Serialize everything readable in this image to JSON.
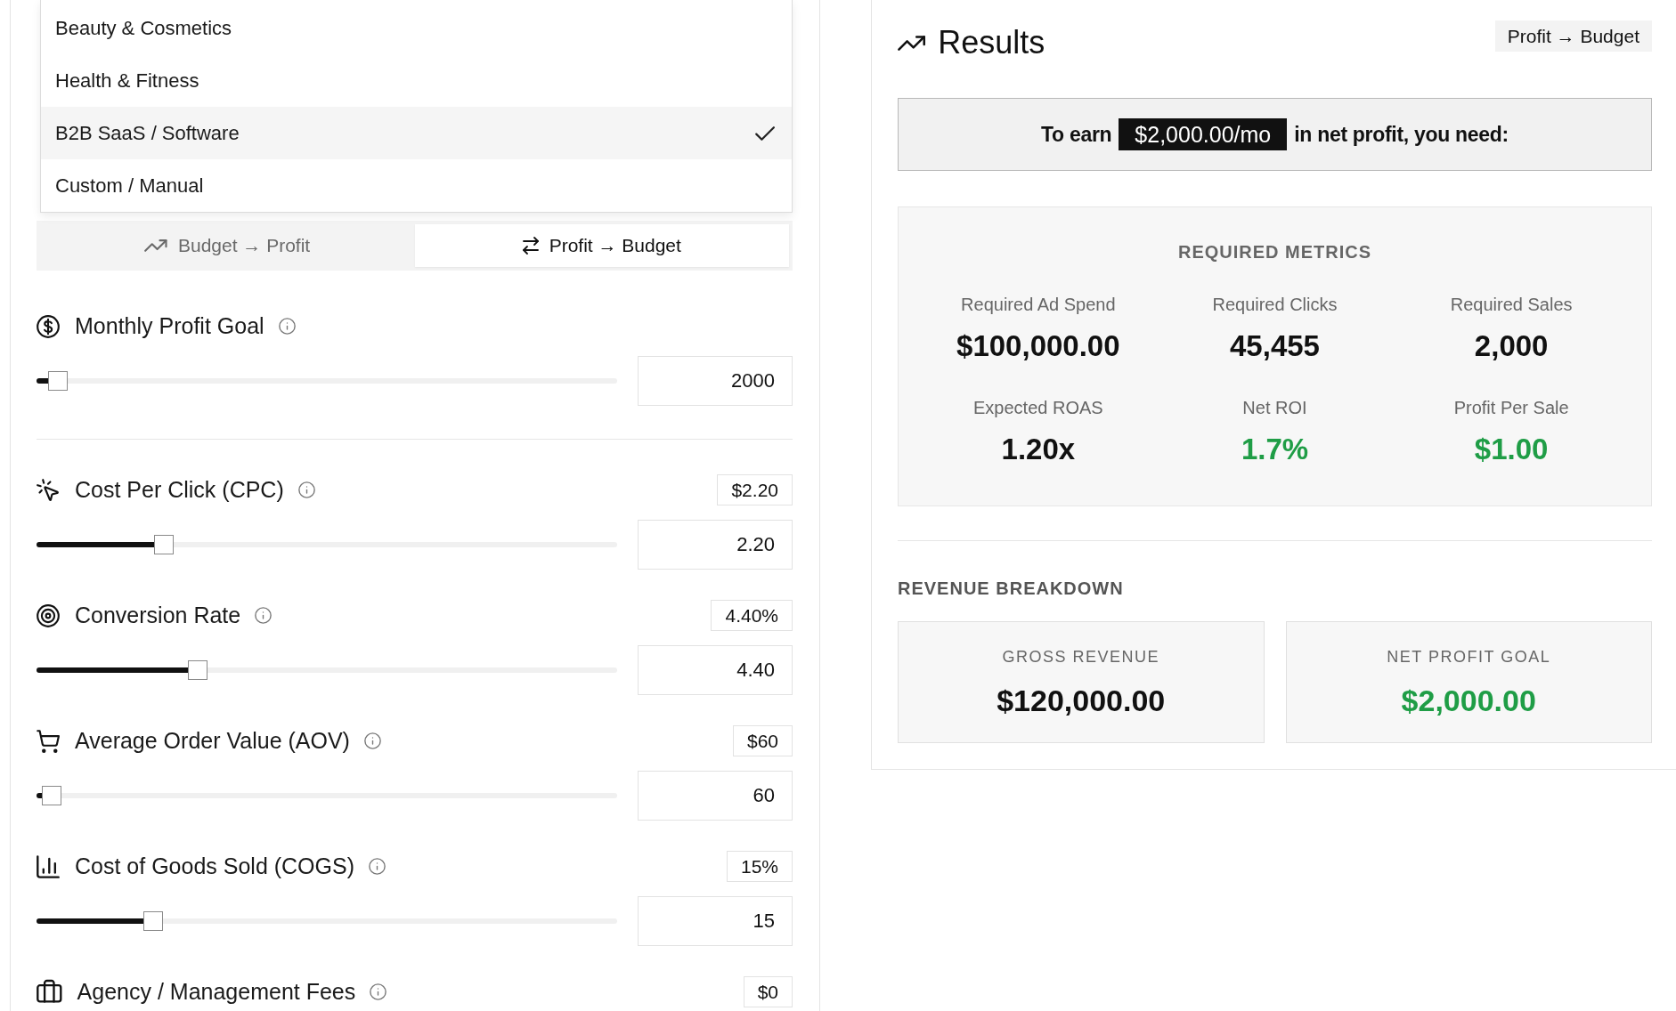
{
  "industry_menu": {
    "options": [
      {
        "label": "Beauty & Cosmetics",
        "selected": false
      },
      {
        "label": "Health & Fitness",
        "selected": false
      },
      {
        "label": "B2B SaaS / Software",
        "selected": true
      },
      {
        "label": "Custom / Manual",
        "selected": false
      }
    ]
  },
  "mode_tabs": [
    {
      "label": "Budget → Profit",
      "selected": false
    },
    {
      "label": "Profit → Budget",
      "selected": true
    }
  ],
  "goal": {
    "label": "Monthly Profit Goal",
    "level": 0.02,
    "value": "2000"
  },
  "inputs": [
    {
      "label": "Cost Per Click (CPC)",
      "badge": "$2.20",
      "level": 0.21,
      "value": "2.20"
    },
    {
      "label": "Conversion Rate",
      "badge": "4.40%",
      "level": 0.27,
      "value": "4.40"
    },
    {
      "label": "Average Order Value (AOV)",
      "badge": "$60",
      "level": 0.01,
      "value": "60"
    },
    {
      "label": "Cost of Goods Sold (COGS)",
      "badge": "15%",
      "level": 0.19,
      "value": "15"
    },
    {
      "label": "Agency / Management Fees",
      "badge": "$0"
    }
  ],
  "results": {
    "title": "Results",
    "mode_badge": "Profit → Budget",
    "summary": {
      "prefix": "To earn",
      "highlight": "$2,000.00/mo",
      "suffix": "in net profit, you need:"
    },
    "required_metrics": {
      "heading": "REQUIRED METRICS",
      "metrics": [
        {
          "label": "Required Ad Spend",
          "value": "$100,000.00",
          "color": "#111111"
        },
        {
          "label": "Required Clicks",
          "value": "45,455",
          "color": "#111111"
        },
        {
          "label": "Required Sales",
          "value": "2,000",
          "color": "#111111"
        },
        {
          "label": "Expected ROAS",
          "value": "1.20x",
          "color": "#111111"
        },
        {
          "label": "Net ROI",
          "value": "1.7%",
          "color": "#1f9d46"
        },
        {
          "label": "Profit Per Sale",
          "value": "$1.00",
          "color": "#1f9d46"
        }
      ]
    },
    "revenue_breakdown": {
      "heading": "REVENUE BREAKDOWN",
      "cards": [
        {
          "label": "GROSS REVENUE",
          "value": "$120,000.00",
          "color": "#111111"
        },
        {
          "label": "NET PROFIT GOAL",
          "value": "$2,000.00",
          "color": "#1f9d46"
        }
      ]
    }
  }
}
